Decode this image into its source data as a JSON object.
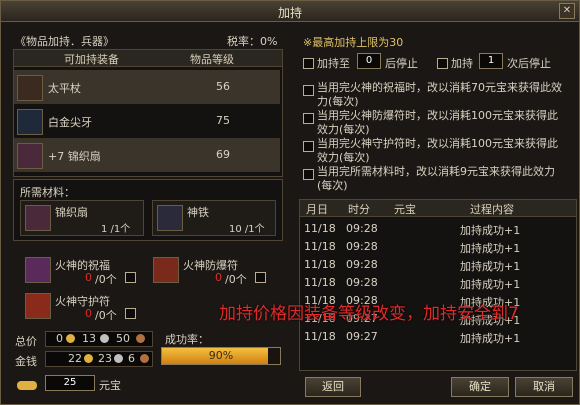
{
  "window": {
    "title": "加持"
  },
  "left": {
    "category": "《物品加持．兵器》",
    "tax_label": "税率：0%",
    "col_equip": "可加持装备",
    "col_level": "物品等级",
    "equipment": [
      {
        "name": "太平杖",
        "level": "56",
        "selected": true
      },
      {
        "name": "白金尖牙",
        "level": "75",
        "selected": false
      },
      {
        "name": "+7 锦织扇",
        "level": "69",
        "selected": true
      }
    ],
    "materials_label": "所需材料：",
    "materials": [
      {
        "name": "锦织扇",
        "count": "1 /1个"
      },
      {
        "name": "神铁",
        "count": "10 /1个"
      }
    ],
    "charms": [
      {
        "name": "火神的祝福",
        "have": "0",
        "need": "/0个"
      },
      {
        "name": "火神防爆符",
        "have": "0",
        "need": "/0个"
      },
      {
        "name": "火神守护符",
        "have": "0",
        "need": "/0个"
      }
    ],
    "total_label": "总价",
    "total": {
      "gold": "0",
      "silver": "13",
      "copper": "50"
    },
    "money_label": "金钱",
    "money": {
      "gold": "22",
      "silver": "23",
      "copper": "6"
    },
    "success_label": "成功率：",
    "success_text": "90%",
    "success_rate": 0.9,
    "yuanbao_value": "25",
    "yuanbao_label": "元宝",
    "back_button": "返回"
  },
  "right": {
    "max_note": "※最高加持上限为30",
    "stop_at_label": "加持至",
    "stop_at_value": "0",
    "stop_at_suffix": "后停止",
    "stop_times_label": "加持",
    "stop_times_value": "1",
    "stop_times_suffix": "次后停止",
    "options": [
      "当用完火神的祝福时，改以消耗70元宝来获得此效力(每次)",
      "当用完火神防爆符时，改以消耗100元宝来获得此效力(每次)",
      "当用完火神守护符时，改以消耗100元宝来获得此效力(每次)",
      "当用完所需材料时，改以消耗9元宝来获得此效力(每次)"
    ],
    "log_headers": [
      "月日",
      "时分",
      "元宝",
      "过程内容"
    ],
    "log": [
      {
        "date": "11/18",
        "time": "09:28",
        "yb": "",
        "content": "加持成功+1"
      },
      {
        "date": "11/18",
        "time": "09:28",
        "yb": "",
        "content": "加持成功+1"
      },
      {
        "date": "11/18",
        "time": "09:28",
        "yb": "",
        "content": "加持成功+1"
      },
      {
        "date": "11/18",
        "time": "09:28",
        "yb": "",
        "content": "加持成功+1"
      },
      {
        "date": "11/18",
        "time": "09:28",
        "yb": "",
        "content": "加持成功+1"
      },
      {
        "date": "11/18",
        "time": "09:27",
        "yb": "",
        "content": "加持成功+1"
      },
      {
        "date": "11/18",
        "time": "09:27",
        "yb": "",
        "content": "加持成功+1"
      }
    ],
    "confirm_button": "确定",
    "cancel_button": "取消"
  },
  "overlay_text": "加持价格因装备等级改变，加持安全到7",
  "colors": {
    "gold_text": "#e0c266",
    "success_bar": "#e8a020",
    "overlay_red": "#e02a2a"
  }
}
